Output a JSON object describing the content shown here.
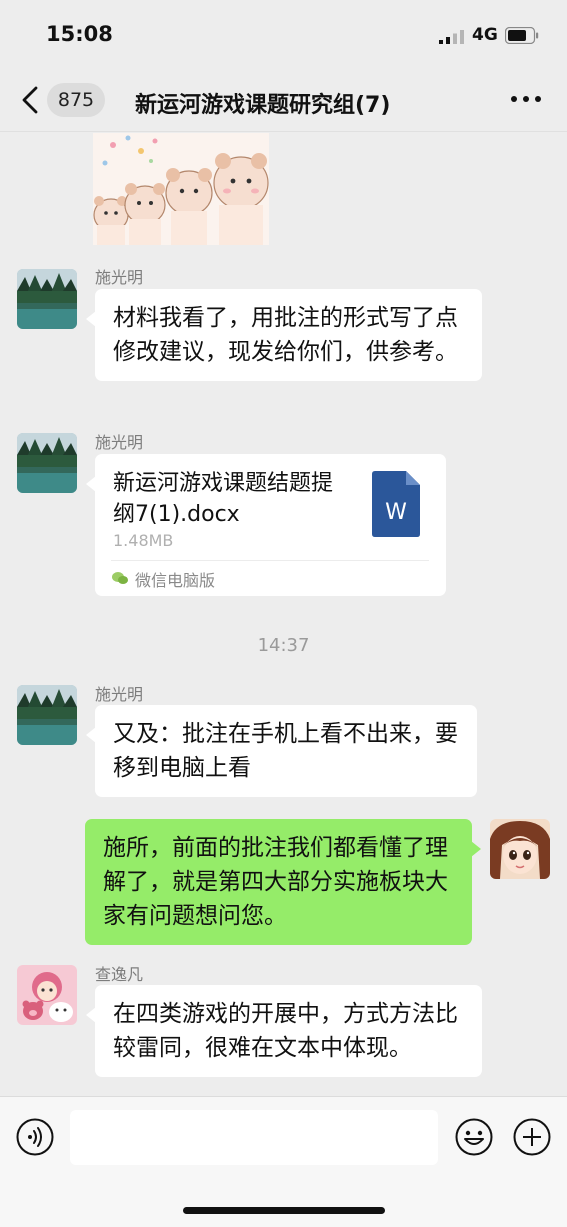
{
  "status_bar": {
    "time": "15:08",
    "network": "4G"
  },
  "nav": {
    "unread_count": "875",
    "title": "新运河游戏课题研究组(7)"
  },
  "messages": [
    {
      "sender": "施光明",
      "text": "材料我看了，用批注的形式写了点修改建议，现发给你们，供参考。"
    },
    {
      "sender": "施光明",
      "file": {
        "name": "新运河游戏课题结题提纲7(1).docx",
        "size": "1.48MB",
        "icon_letter": "W",
        "source": "微信电脑版"
      }
    },
    {
      "timestamp": "14:37"
    },
    {
      "sender": "施光明",
      "text": "又及：批注在手机上看不出来，要移到电脑上看"
    },
    {
      "self": true,
      "text": "施所，前面的批注我们都看懂了理解了，就是第四大部分实施板块大家有问题想问您。"
    },
    {
      "sender": "查逸凡",
      "text": "在四类游戏的开展中，方式方法比较雷同，很难在文本中体现。"
    }
  ],
  "colors": {
    "self_bubble": "#95ec69",
    "background": "#ededed",
    "word_icon": "#2b579a"
  },
  "icons": [
    "back-chevron-icon",
    "more-icon",
    "word-file-icon",
    "wechat-pc-icon",
    "voice-icon",
    "emoji-icon",
    "plus-icon"
  ]
}
